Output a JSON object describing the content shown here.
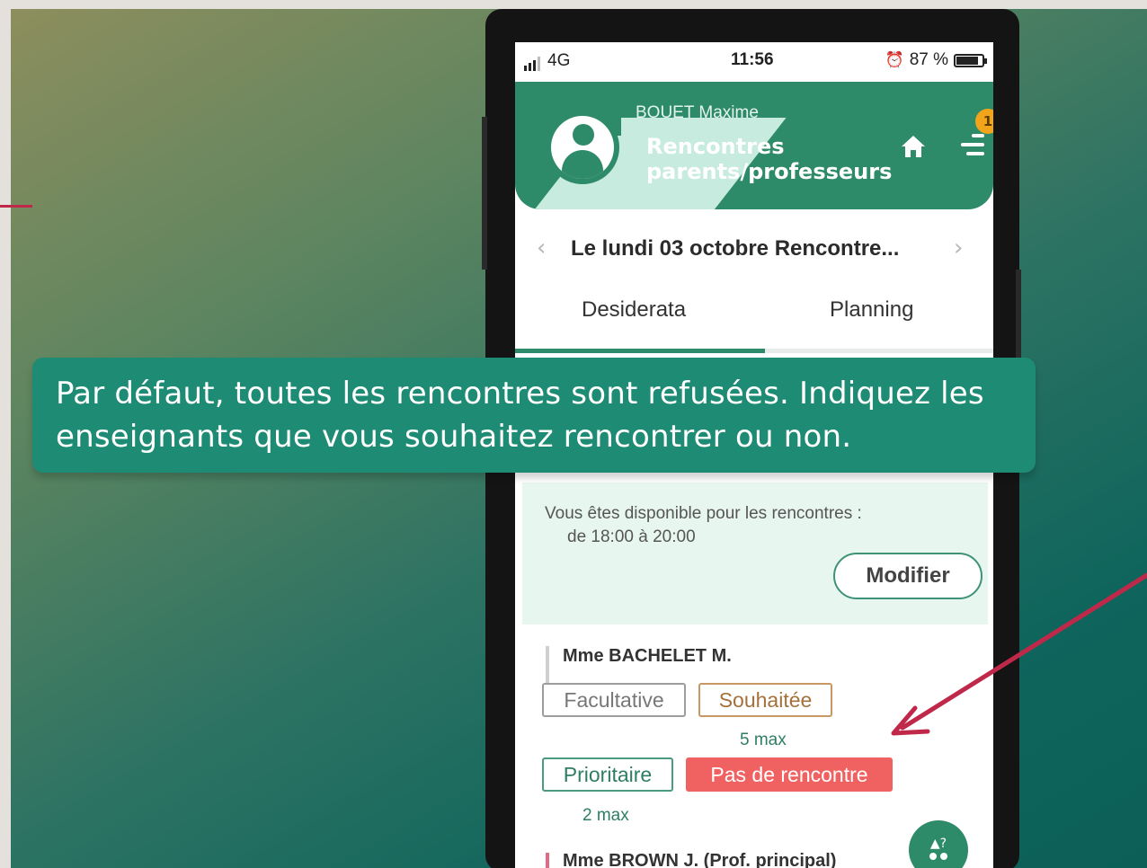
{
  "status_bar": {
    "network": "4G",
    "time": "11:56",
    "battery": "87 %"
  },
  "header": {
    "user_name": "BOUET Maxime",
    "title": "Rencontres parents/professeurs",
    "menu_badge": "1"
  },
  "date_nav": {
    "label": "Le lundi 03 octobre Rencontre..."
  },
  "tabs": [
    {
      "label": "Desiderata",
      "active": true
    },
    {
      "label": "Planning",
      "active": false
    }
  ],
  "banner": {
    "text": "Par défaut, toutes les rencontres sont refusées. Indiquez les enseignants que vous souhaitez rencontrer ou non."
  },
  "availability": {
    "text": "Vous êtes disponible pour les rencontres :",
    "time": "de 18:00 à 20:00",
    "modify_label": "Modifier"
  },
  "teachers": [
    {
      "name": "Mme BACHELET M.",
      "options": {
        "facultative": "Facultative",
        "souhaitee": "Souhaitée",
        "souhaitee_max": "5 max",
        "prioritaire": "Prioritaire",
        "prioritaire_max": "2 max",
        "pas_de_rencontre": "Pas de rencontre"
      },
      "selected": "Pas de rencontre"
    },
    {
      "name": "Mme BROWN J. (Prof. principal)"
    }
  ],
  "colors": {
    "primary_green": "#2e8b6a",
    "banner_green": "#1e8b74",
    "selected_red": "#f06261",
    "arrow_red": "#c0284a"
  },
  "icons": {
    "home": "home-icon",
    "menu": "menu-icon",
    "avatar": "user-icon",
    "help": "help-icon"
  }
}
